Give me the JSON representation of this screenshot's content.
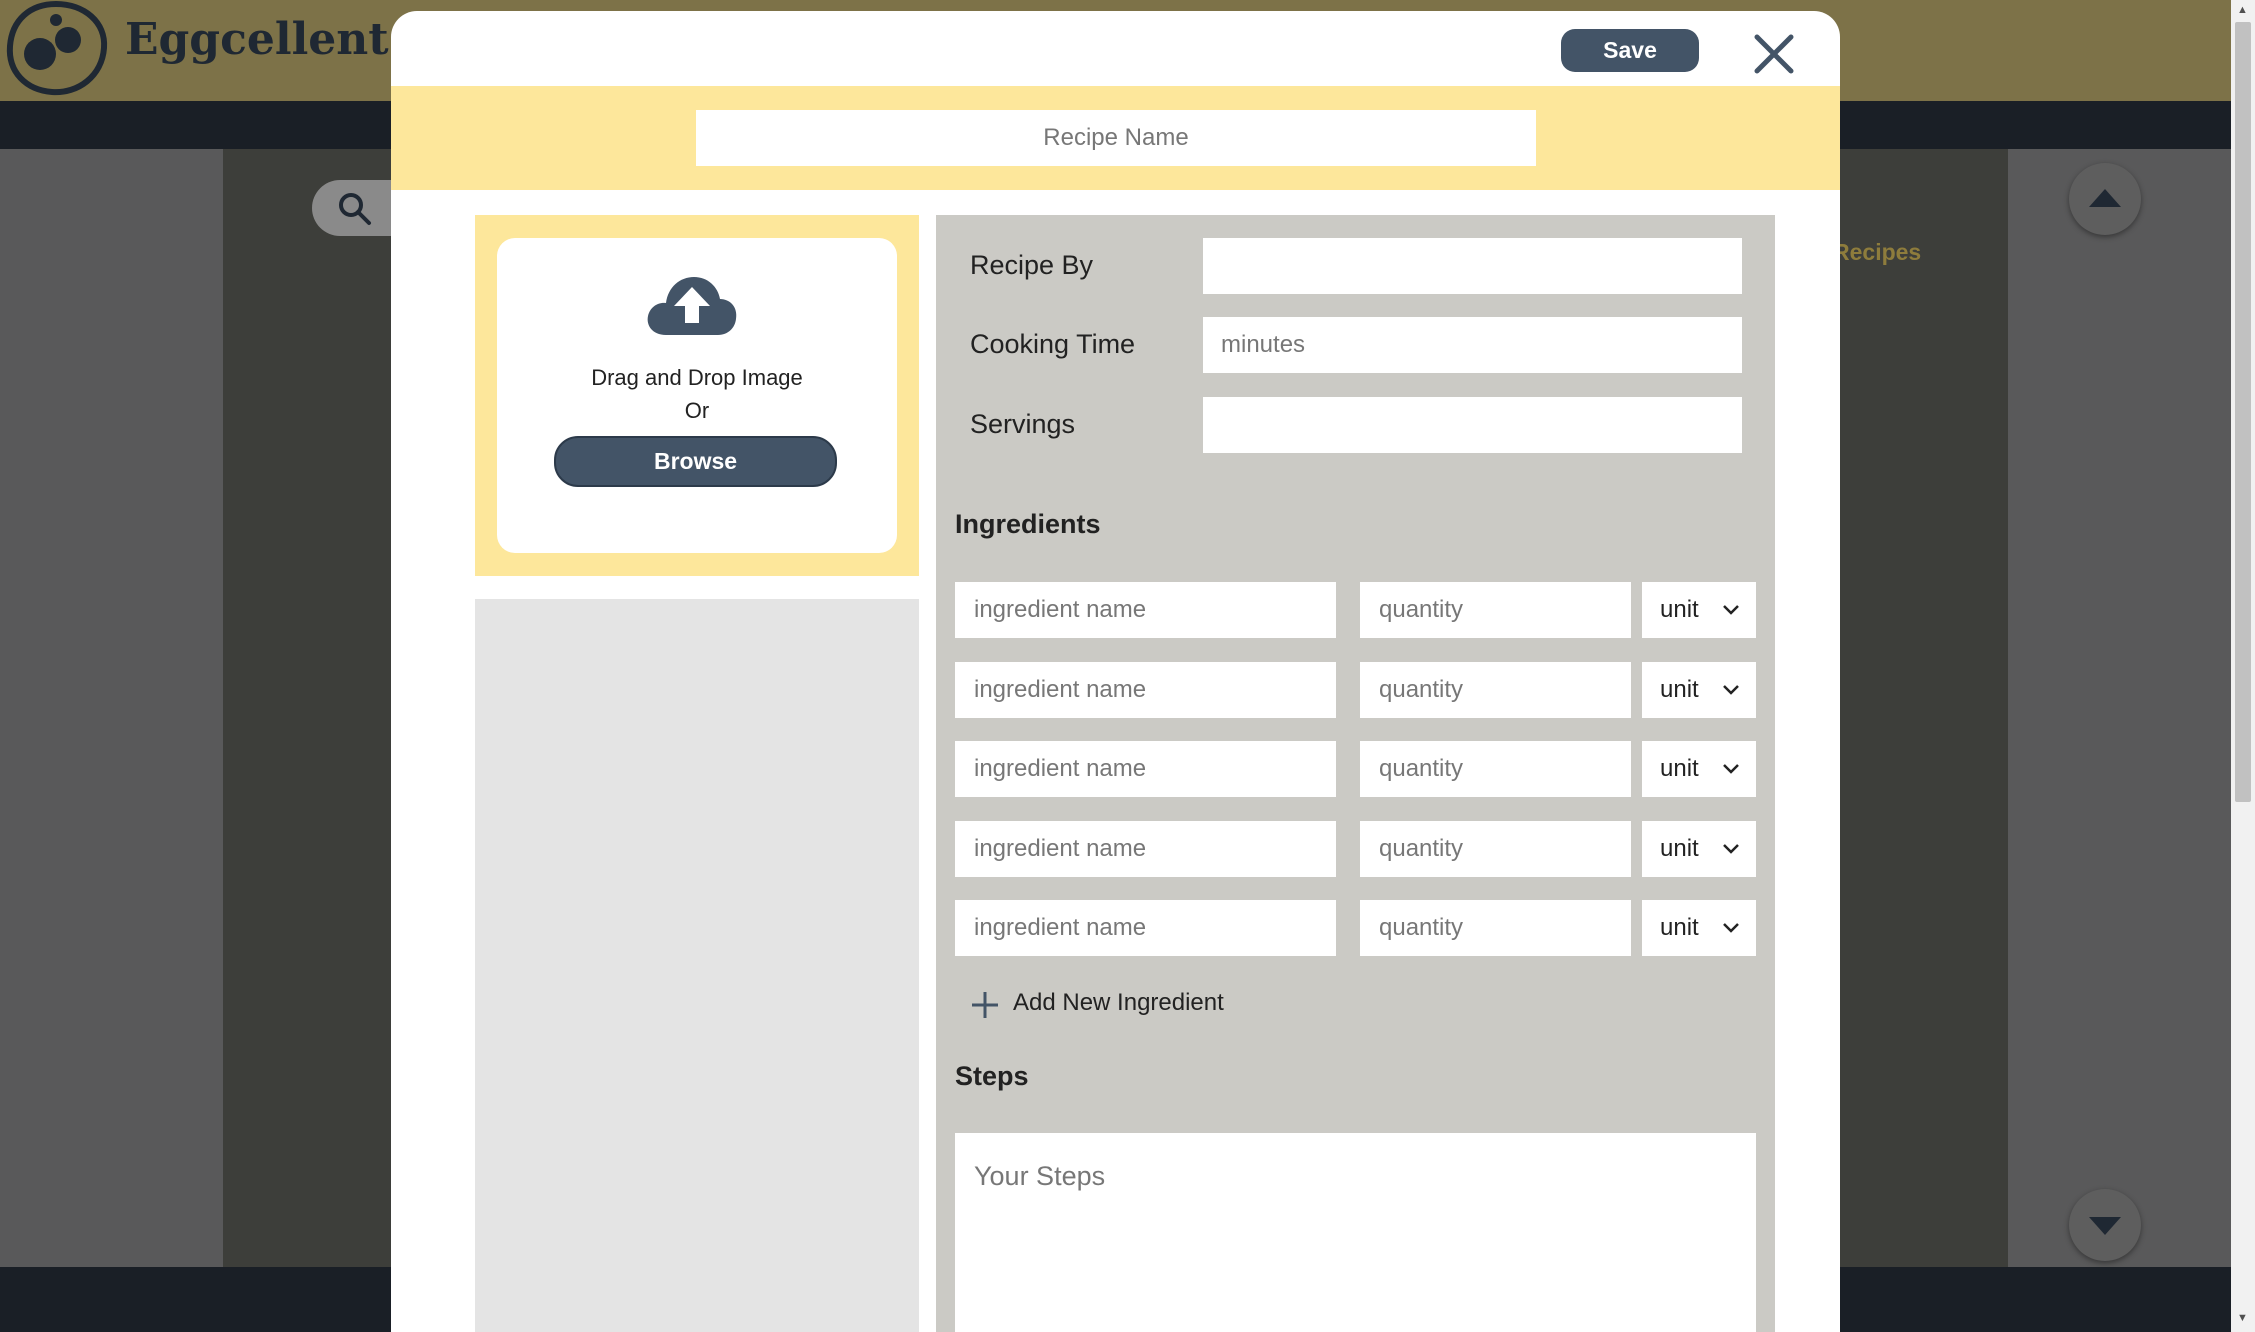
{
  "app": {
    "brand": "Eggcellent",
    "background_link": "Recipes"
  },
  "modal": {
    "save_label": "Save",
    "recipe_name_placeholder": "Recipe Name",
    "upload": {
      "drag_text": "Drag and Drop Image",
      "or_text": "Or",
      "browse_label": "Browse"
    },
    "fields": {
      "recipe_by_label": "Recipe By",
      "recipe_by_value": "",
      "cooking_time_label": "Cooking Time",
      "cooking_time_placeholder": "minutes",
      "servings_label": "Servings",
      "servings_value": ""
    },
    "ingredients": {
      "title": "Ingredients",
      "rows": [
        {
          "name_placeholder": "ingredient name",
          "quantity_placeholder": "quantity",
          "unit": "unit"
        },
        {
          "name_placeholder": "ingredient name",
          "quantity_placeholder": "quantity",
          "unit": "unit"
        },
        {
          "name_placeholder": "ingredient name",
          "quantity_placeholder": "quantity",
          "unit": "unit"
        },
        {
          "name_placeholder": "ingredient name",
          "quantity_placeholder": "quantity",
          "unit": "unit"
        },
        {
          "name_placeholder": "ingredient name",
          "quantity_placeholder": "quantity",
          "unit": "unit"
        }
      ],
      "add_label": "Add New Ingredient"
    },
    "steps": {
      "title": "Steps",
      "placeholder": "Your Steps"
    }
  },
  "colors": {
    "accent_dark": "#435467",
    "band_yellow": "#fde79b",
    "panel_gray": "#cbcac5"
  }
}
